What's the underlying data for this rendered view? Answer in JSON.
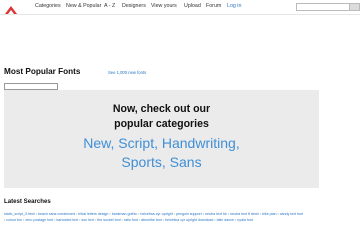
{
  "colors": {
    "link": "#2a76c6",
    "category": "#3f8fd6",
    "promo_bg": "#ebebeb",
    "logo": "#d33"
  },
  "header": {
    "logo_icon": "font-logo-icon",
    "nav": [
      "Categories",
      "New & Popular",
      "A - Z",
      "Designers",
      "View yours",
      "Upload",
      "Forum",
      "Log in"
    ],
    "search_placeholder": ""
  },
  "main": {
    "title": "Most Popular Fonts",
    "see_all": "See 1,000 new fonts",
    "promo": {
      "line1": "Now, check out our",
      "line2": "popular categories",
      "categories": [
        "New",
        "Script",
        "Handwriting",
        "Sports",
        "Sans"
      ]
    }
  },
  "latest": {
    "title": "Latest Searches",
    "items": [
      "static_script_3.html",
      "beach sans condensed",
      "tribal letters design",
      "bankman gothic",
      "helvetica-cyr-upright",
      "penguin support",
      "neutra text bk",
      "neutra text tf demi",
      "bike plan",
      "candy text font",
      "colour fun",
      "zero postage font",
      "barcoded text",
      "sun text",
      "the socket font",
      "ratio font",
      "absinthe font",
      "helvetica cyr upright download",
      "latin dance",
      "nyala font"
    ]
  }
}
